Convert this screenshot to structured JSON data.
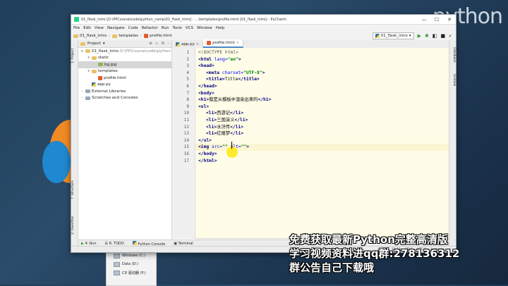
{
  "background": {
    "logo_text": "python"
  },
  "window": {
    "title": "01_flask_intro [D:\\PPCourse\\code\\python_camp\\01_flask_intro] - ...\\templates\\profile.html [01_flask_intro] - PyCharm",
    "controls": [
      "—",
      "☐",
      "✕"
    ]
  },
  "menu": [
    "File",
    "Edit",
    "View",
    "Navigate",
    "Code",
    "Refactor",
    "Run",
    "Tools",
    "VCS",
    "Window",
    "Help"
  ],
  "nav": {
    "crumbs": [
      "01_flask_intro",
      "templates",
      "profile.html"
    ],
    "run_config": "01_flask_intro"
  },
  "left_strip": [
    "1: Project",
    "2: Favorites",
    "7: Structure"
  ],
  "right_strip": [
    "Database",
    "SciView"
  ],
  "project": {
    "header": "Project",
    "tree": [
      {
        "label": "01_flask_intro",
        "note": "D:\\PP\\Course\\code\\python",
        "indent": 0,
        "arrow": "▾",
        "icon": "folder"
      },
      {
        "label": "static",
        "indent": 1,
        "arrow": "▾",
        "icon": "folder"
      },
      {
        "label": "bg.jpg",
        "indent": 2,
        "arrow": "",
        "icon": "img",
        "selected": true
      },
      {
        "label": "templates",
        "indent": 1,
        "arrow": "▾",
        "icon": "folder"
      },
      {
        "label": "profile.html",
        "indent": 2,
        "arrow": "",
        "icon": "html"
      },
      {
        "label": "app.py",
        "indent": 1,
        "arrow": "",
        "icon": "py"
      },
      {
        "label": "External Libraries",
        "indent": 0,
        "arrow": "›",
        "icon": "lib"
      },
      {
        "label": "Scratches and Consoles",
        "indent": 0,
        "arrow": "›",
        "icon": "scratch"
      }
    ]
  },
  "editor": {
    "tabs": [
      {
        "label": "app.py",
        "active": false
      },
      {
        "label": "profile.html",
        "active": true
      }
    ],
    "line_numbers": [
      "1",
      "2",
      "3",
      "4",
      "5",
      "6",
      "7",
      "8",
      "9",
      "10",
      "11",
      "12",
      "13",
      "14",
      "15",
      "16",
      "17"
    ],
    "lines": [
      {
        "indent": 0,
        "parts": [
          [
            "doct",
            "<!DOCTYPE html>"
          ]
        ]
      },
      {
        "indent": 0,
        "parts": [
          [
            "tag",
            "<html "
          ],
          [
            "attr",
            "lang="
          ],
          [
            "str",
            "\"en\""
          ],
          [
            "tag",
            ">"
          ]
        ]
      },
      {
        "indent": 0,
        "parts": [
          [
            "tag",
            "<head>"
          ]
        ]
      },
      {
        "indent": 1,
        "parts": [
          [
            "tag",
            "<meta "
          ],
          [
            "attr",
            "charset="
          ],
          [
            "str",
            "\"UTF-8\""
          ],
          [
            "tag",
            ">"
          ]
        ]
      },
      {
        "indent": 1,
        "parts": [
          [
            "tag",
            "<title>"
          ],
          [
            "txt",
            "Title"
          ],
          [
            "tag",
            "</title>"
          ]
        ]
      },
      {
        "indent": 0,
        "parts": [
          [
            "tag",
            "</head>"
          ]
        ]
      },
      {
        "indent": 0,
        "parts": [
          [
            "tag",
            "<body>"
          ]
        ]
      },
      {
        "indent": 0,
        "parts": [
          [
            "tag",
            "<h1>"
          ],
          [
            "txt",
            "我是从模板中渲染出来的"
          ],
          [
            "tag",
            "</h1>"
          ]
        ]
      },
      {
        "indent": 0,
        "parts": [
          [
            "tag",
            "<ul>"
          ]
        ]
      },
      {
        "indent": 1,
        "parts": [
          [
            "tag",
            "<li>"
          ],
          [
            "txt",
            "西游记"
          ],
          [
            "tag",
            "</li>"
          ]
        ]
      },
      {
        "indent": 1,
        "parts": [
          [
            "tag",
            "<li>"
          ],
          [
            "txt",
            "三国演义"
          ],
          [
            "tag",
            "</li>"
          ]
        ]
      },
      {
        "indent": 1,
        "parts": [
          [
            "tag",
            "<li>"
          ],
          [
            "txt",
            "水浒传"
          ],
          [
            "tag",
            "</li>"
          ]
        ]
      },
      {
        "indent": 1,
        "parts": [
          [
            "tag",
            "<li>"
          ],
          [
            "txt",
            "红楼梦"
          ],
          [
            "tag",
            "</li>"
          ]
        ]
      },
      {
        "indent": 0,
        "parts": [
          [
            "tag",
            "</ul>"
          ]
        ]
      },
      {
        "indent": 0,
        "current": true,
        "parts": [
          [
            "tag",
            "<img "
          ],
          [
            "attr",
            "src="
          ],
          [
            "str",
            "\"\" "
          ],
          [
            "attr",
            "alt="
          ],
          [
            "str",
            "\"\""
          ],
          [
            "tag",
            ">"
          ]
        ]
      },
      {
        "indent": 0,
        "parts": [
          [
            "tag",
            "</body>"
          ]
        ]
      },
      {
        "indent": 0,
        "parts": [
          [
            "tag",
            "</html>"
          ]
        ]
      }
    ],
    "breadcrumb": [
      "html",
      "body",
      "img"
    ]
  },
  "bottom_tools": [
    "4: Run",
    "6: TODO",
    "Python Console",
    "Terminal"
  ],
  "status": [
    "15:10",
    "CRLF",
    "UTF-8",
    "4 spaces"
  ],
  "explorer": [
    "Windows (C:)",
    "Data (D:)",
    "CD 驱动器 (F:)"
  ],
  "overlay": {
    "line1": "免费获取最新Python完整高清版",
    "line2": "学习视频资料进qq群:278136312",
    "line3": "群公告自己下载哦"
  }
}
